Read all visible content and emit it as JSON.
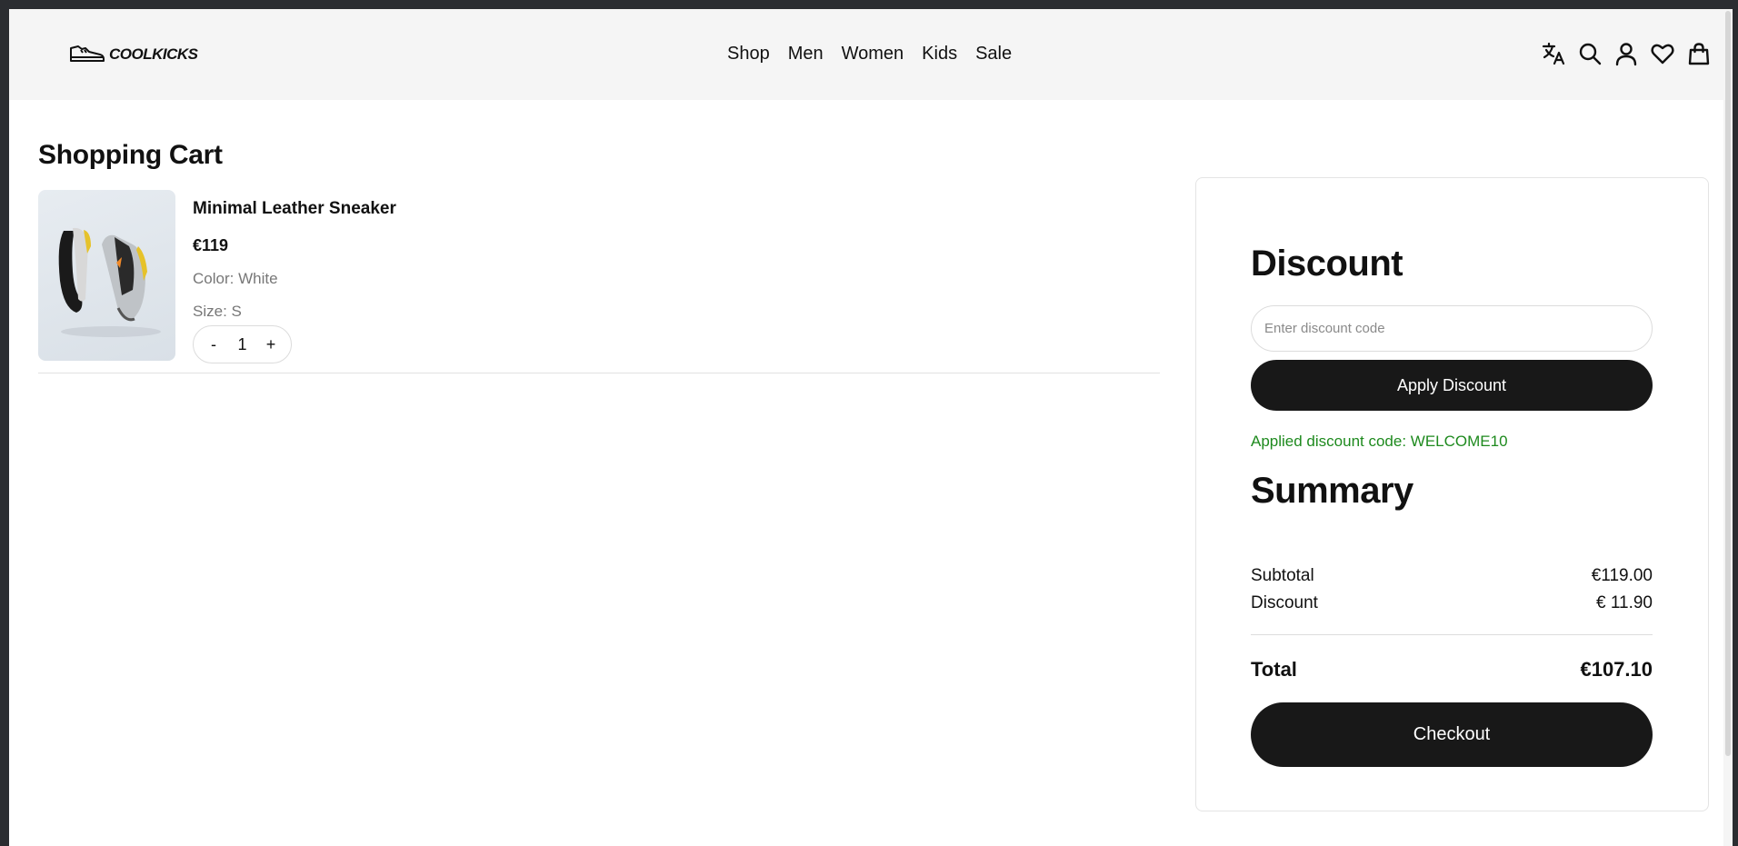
{
  "header": {
    "logo_text": "COOLKICKS",
    "nav": [
      "Shop",
      "Men",
      "Women",
      "Kids",
      "Sale"
    ],
    "icons": [
      "translate-icon",
      "search-icon",
      "user-icon",
      "heart-icon",
      "bag-icon"
    ]
  },
  "cart": {
    "title": "Shopping Cart",
    "item": {
      "name": "Minimal Leather Sneaker",
      "price": "€119",
      "color": "Color: White",
      "size": "Size: S",
      "quantity": "1",
      "decrement_label": "-",
      "increment_label": "+"
    }
  },
  "discount": {
    "title": "Discount",
    "placeholder": "Enter discount code",
    "value": "",
    "apply_label": "Apply Discount",
    "applied_message": "Applied discount code: WELCOME10",
    "applied_color": "#1e8a1e"
  },
  "summary": {
    "title": "Summary",
    "subtotal_label": "Subtotal",
    "subtotal_value": "€119.00",
    "discount_label": "Discount",
    "discount_value": "€ 11.90",
    "total_label": "Total",
    "total_value": "€107.10",
    "checkout_label": "Checkout"
  },
  "colors": {
    "primary_button": "#181818",
    "header_bg": "#f5f5f5"
  }
}
